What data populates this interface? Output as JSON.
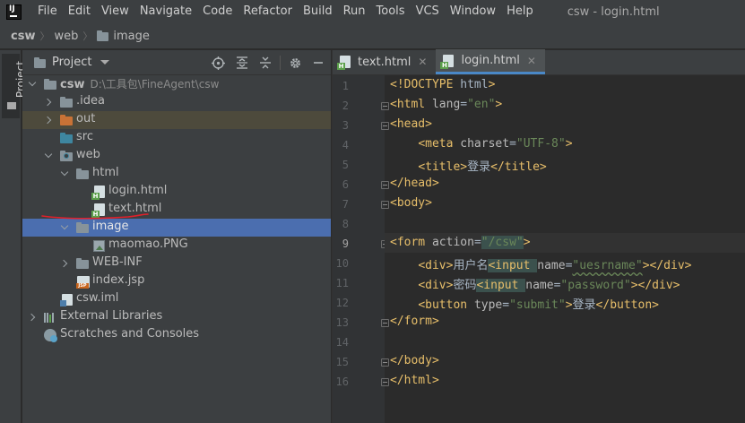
{
  "menubar": {
    "items": [
      "File",
      "Edit",
      "View",
      "Navigate",
      "Code",
      "Refactor",
      "Build",
      "Run",
      "Tools",
      "VCS",
      "Window",
      "Help"
    ],
    "window_title": "csw - login.html"
  },
  "breadcrumb": {
    "items": [
      "csw",
      "web",
      "image"
    ]
  },
  "tool_stripe": {
    "project_label": "Project"
  },
  "project_panel": {
    "title": "Project",
    "header_icons": [
      "crosshair-icon",
      "expand-all-icon",
      "collapse-all-icon",
      "gear-icon",
      "minimize-icon"
    ],
    "tree": [
      {
        "label": "csw",
        "path": "D:\\工具包\\FineAgent\\csw",
        "icon": "project-folder-icon",
        "expanded": true
      },
      {
        "label": ".idea",
        "icon": "folder-icon",
        "expanded": false
      },
      {
        "label": "out",
        "icon": "excluded-folder-icon",
        "expanded": false
      },
      {
        "label": "src",
        "icon": "source-folder-icon"
      },
      {
        "label": "web",
        "icon": "web-folder-icon",
        "expanded": true
      },
      {
        "label": "html",
        "icon": "folder-icon",
        "expanded": true
      },
      {
        "label": "login.html",
        "icon": "html-file-icon"
      },
      {
        "label": "text.html",
        "icon": "html-file-icon"
      },
      {
        "label": "image",
        "icon": "folder-icon",
        "expanded": true,
        "selected": true
      },
      {
        "label": "maomao.PNG",
        "icon": "image-file-icon"
      },
      {
        "label": "WEB-INF",
        "icon": "folder-icon",
        "expanded": false
      },
      {
        "label": "index.jsp",
        "icon": "jsp-file-icon"
      },
      {
        "label": "csw.iml",
        "icon": "iml-file-icon"
      },
      {
        "label": "External Libraries",
        "icon": "library-icon",
        "expanded": false
      },
      {
        "label": "Scratches and Consoles",
        "icon": "scratches-icon"
      }
    ]
  },
  "editor": {
    "tabs": [
      {
        "label": "text.html",
        "active": false
      },
      {
        "label": "login.html",
        "active": true
      }
    ],
    "current_line": 9,
    "lines": [
      {
        "n": "1",
        "parts": [
          [
            "tag",
            "<!DOCTYPE "
          ],
          [
            "txt",
            "html"
          ],
          [
            "tag",
            ">"
          ]
        ]
      },
      {
        "n": "2",
        "parts": [
          [
            "tag",
            "<html "
          ],
          [
            "attr",
            "lang"
          ],
          [
            "txt",
            "="
          ],
          [
            "str",
            "\"en\""
          ],
          [
            "tag",
            ">"
          ]
        ]
      },
      {
        "n": "3",
        "parts": [
          [
            "tag",
            "<head>"
          ]
        ]
      },
      {
        "n": "4",
        "parts": [
          [
            "txt",
            "    "
          ],
          [
            "tag",
            "<meta "
          ],
          [
            "attr",
            "charset"
          ],
          [
            "txt",
            "="
          ],
          [
            "str",
            "\"UTF-8\""
          ],
          [
            "tag",
            ">"
          ]
        ]
      },
      {
        "n": "5",
        "parts": [
          [
            "txt",
            "    "
          ],
          [
            "tag",
            "<title>"
          ],
          [
            "txt",
            "登录"
          ],
          [
            "tag",
            "</title>"
          ]
        ]
      },
      {
        "n": "6",
        "parts": [
          [
            "tag",
            "</head>"
          ]
        ]
      },
      {
        "n": "7",
        "parts": [
          [
            "tag",
            "<body>"
          ]
        ]
      },
      {
        "n": "8",
        "parts": []
      },
      {
        "n": "9",
        "parts": [
          [
            "tag",
            "<form "
          ],
          [
            "attr",
            "action"
          ],
          [
            "txt",
            "="
          ],
          [
            "str",
            "\"/csw\""
          ],
          [
            "tag",
            ">"
          ]
        ]
      },
      {
        "n": "10",
        "parts": [
          [
            "txt",
            "    "
          ],
          [
            "tag",
            "<div>"
          ],
          [
            "txt",
            "用户名"
          ],
          [
            "tag",
            "<input "
          ],
          [
            "attr",
            "name"
          ],
          [
            "txt",
            "="
          ],
          [
            "str",
            "\"uesrname\""
          ],
          [
            "tag",
            "></div>"
          ]
        ]
      },
      {
        "n": "11",
        "parts": [
          [
            "txt",
            "    "
          ],
          [
            "tag",
            "<div>"
          ],
          [
            "txt",
            "密码"
          ],
          [
            "tag",
            "<input "
          ],
          [
            "attr",
            "name"
          ],
          [
            "txt",
            "="
          ],
          [
            "str",
            "\"password\""
          ],
          [
            "tag",
            "></div>"
          ]
        ]
      },
      {
        "n": "12",
        "parts": [
          [
            "txt",
            "    "
          ],
          [
            "tag",
            "<button "
          ],
          [
            "attr",
            "type"
          ],
          [
            "txt",
            "="
          ],
          [
            "str",
            "\"submit\""
          ],
          [
            "tag",
            ">"
          ],
          [
            "txt",
            "登录"
          ],
          [
            "tag",
            "</button>"
          ]
        ]
      },
      {
        "n": "13",
        "parts": [
          [
            "tag",
            "</form>"
          ]
        ]
      },
      {
        "n": "14",
        "parts": []
      },
      {
        "n": "15",
        "parts": [
          [
            "tag",
            "</body>"
          ]
        ]
      },
      {
        "n": "16",
        "parts": [
          [
            "tag",
            "</html>"
          ]
        ]
      }
    ]
  },
  "colors": {
    "selection": "#4b6eaf",
    "tag": "#e8bf6a",
    "string": "#6a8759",
    "annotation_red": "#e0202a"
  }
}
